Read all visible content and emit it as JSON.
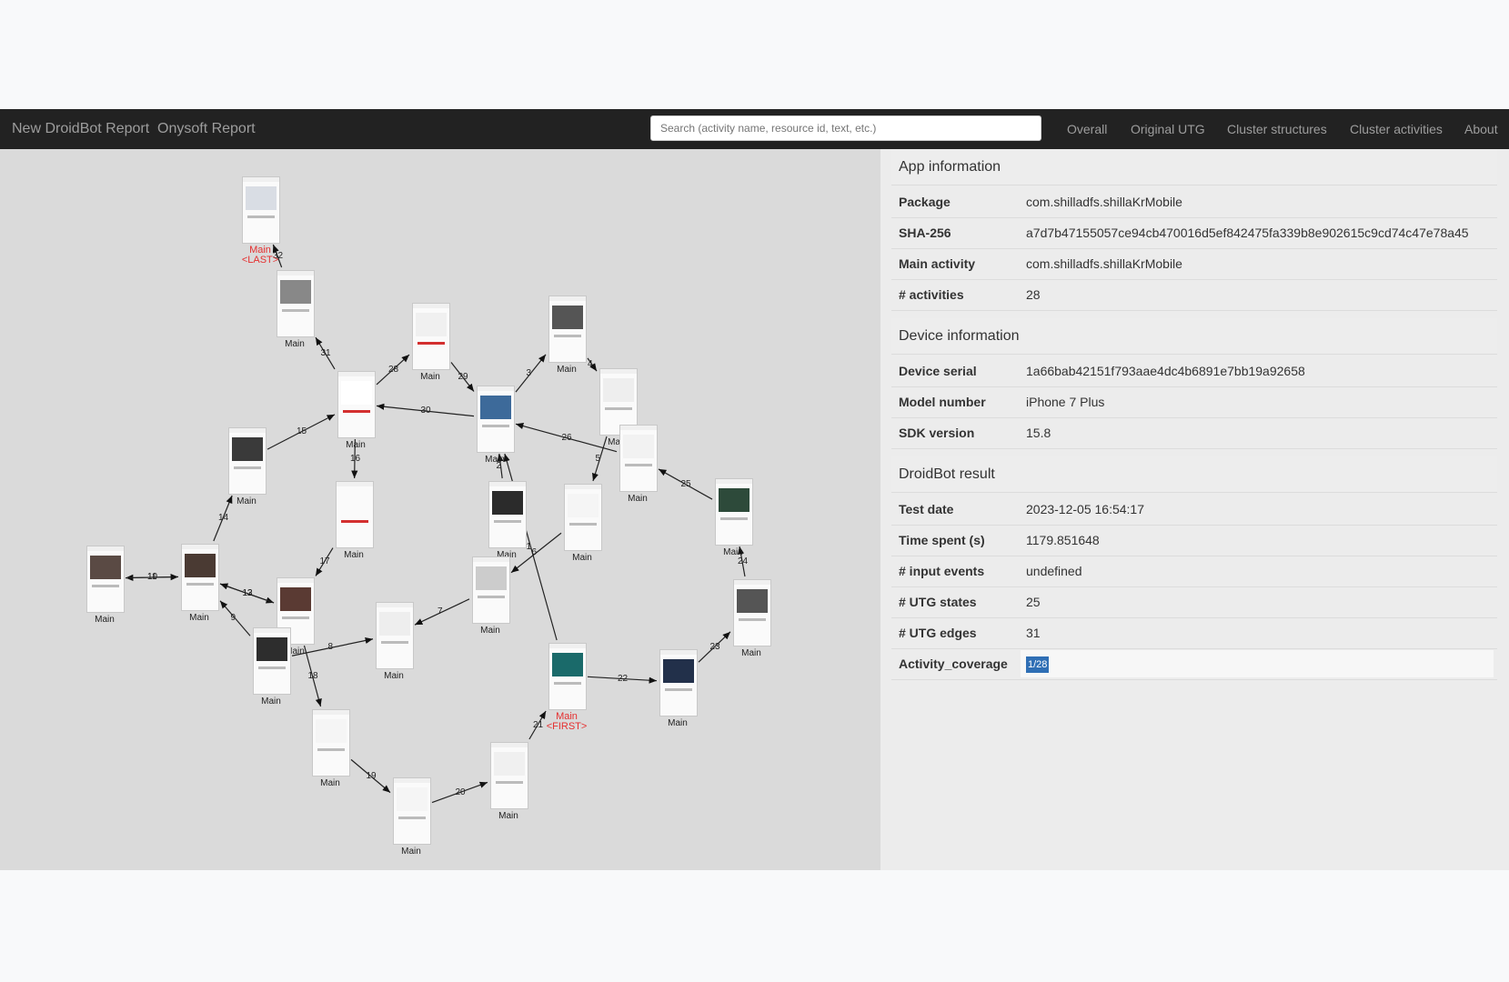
{
  "navbar": {
    "brand": "New DroidBot Report",
    "brand2": "Onysoft Report",
    "search_placeholder": "Search (activity name, resource id, text, etc.)",
    "links": [
      "Overall",
      "Original UTG",
      "Cluster structures",
      "Cluster activities",
      "About"
    ]
  },
  "graph": {
    "nodes": [
      {
        "label": "Main",
        "tag": ""
      },
      {
        "label": "Main",
        "tag": "<LAST>"
      },
      {
        "label": "Main",
        "tag": "<FIRST>"
      }
    ],
    "edge_labels": [
      "1",
      "2",
      "3",
      "4",
      "5",
      "6",
      "7",
      "8",
      "9",
      "10",
      "11",
      "12",
      "13",
      "14",
      "15",
      "16",
      "17",
      "18",
      "19",
      "20",
      "21",
      "22",
      "23",
      "24",
      "25",
      "26",
      "28",
      "29",
      "30",
      "31",
      "32"
    ]
  },
  "app_info": {
    "title": "App information",
    "rows": [
      {
        "key": "Package",
        "value": "com.shilladfs.shillaKrMobile"
      },
      {
        "key": "SHA-256",
        "value": "a7d7b47155057ce94cb470016d5ef842475fa339b8e902615c9cd74c47e78a45"
      },
      {
        "key": "Main activity",
        "value": "com.shilladfs.shillaKrMobile"
      },
      {
        "key": "# activities",
        "value": "28"
      }
    ]
  },
  "device_info": {
    "title": "Device information",
    "rows": [
      {
        "key": "Device serial",
        "value": "1a66bab42151f793aae4dc4b6891e7bb19a92658"
      },
      {
        "key": "Model number",
        "value": "iPhone 7 Plus"
      },
      {
        "key": "SDK version",
        "value": "15.8"
      }
    ]
  },
  "result": {
    "title": "DroidBot result",
    "rows": [
      {
        "key": "Test date",
        "value": "2023-12-05 16:54:17"
      },
      {
        "key": "Time spent (s)",
        "value": "1179.851648"
      },
      {
        "key": "# input events",
        "value": "undefined"
      },
      {
        "key": "# UTG states",
        "value": "25"
      },
      {
        "key": "# UTG edges",
        "value": "31"
      },
      {
        "key": "Activity_coverage",
        "value": "1/28"
      }
    ]
  }
}
